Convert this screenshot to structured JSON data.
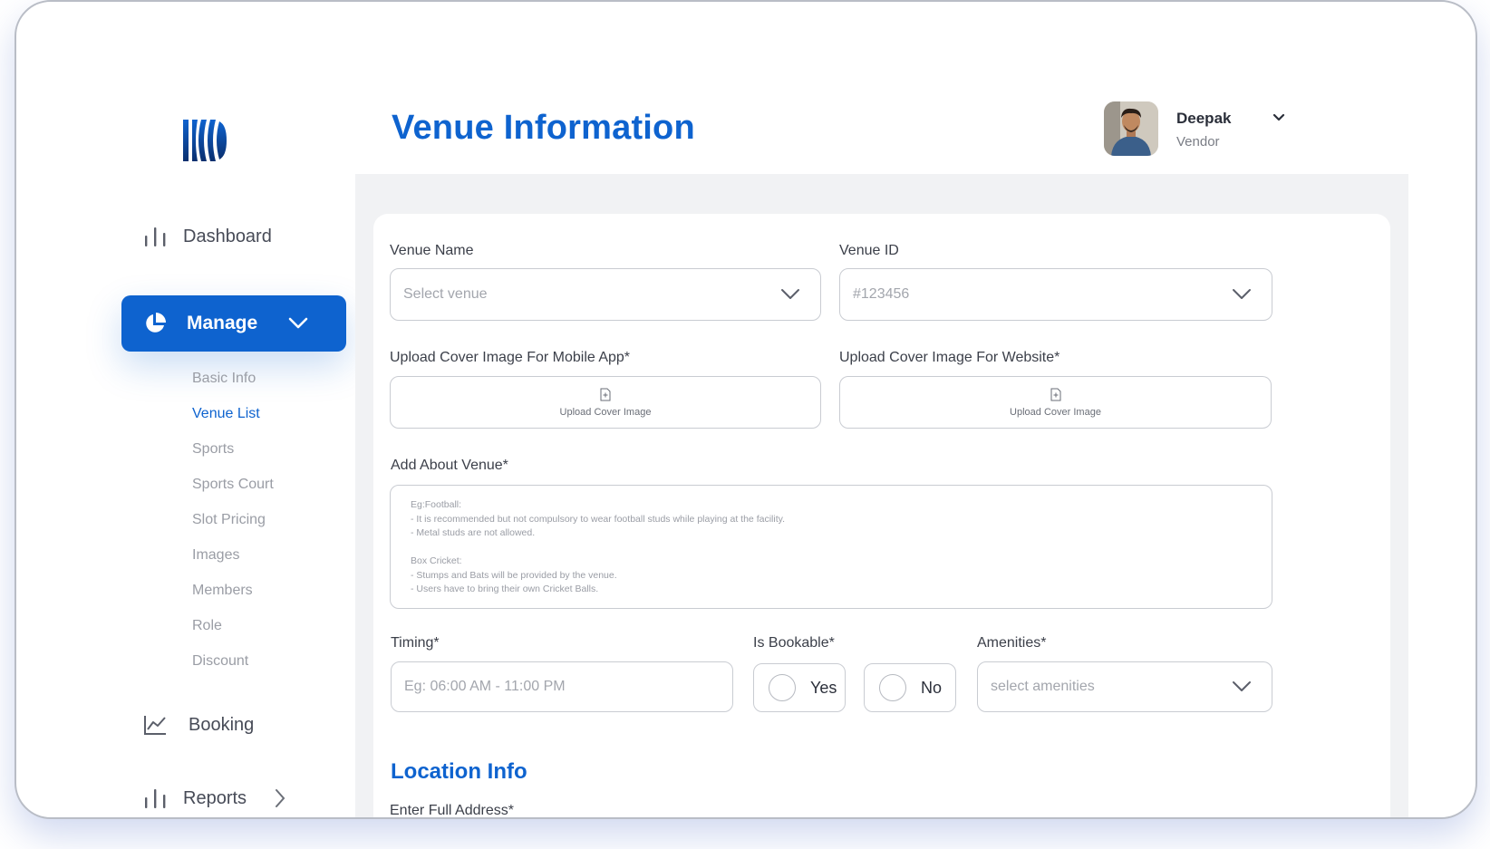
{
  "brand": {
    "logo_icon": "stripes-circle-logo",
    "accent": "#0e63cf"
  },
  "sidebar": {
    "dashboard_label": "Dashboard",
    "manage_label": "Manage",
    "submenu": [
      "Basic Info",
      "Venue List",
      "Sports",
      "Sports Court",
      "Slot Pricing",
      "Images",
      "Members",
      "Role",
      "Discount"
    ],
    "active_submenu": "Venue List",
    "booking_label": "Booking",
    "reports_label": "Reports"
  },
  "header": {
    "title": "Venue Information",
    "user": {
      "name": "Deepak",
      "role": "Vendor"
    }
  },
  "form": {
    "venue_name": {
      "label": "Venue Name",
      "placeholder": "Select venue"
    },
    "venue_id": {
      "label": "Venue ID",
      "placeholder": "#123456"
    },
    "cover_mobile": {
      "label": "Upload Cover Image For Mobile App*",
      "button_text": "Upload Cover Image"
    },
    "cover_web": {
      "label": "Upload Cover Image For Website*",
      "button_text": "Upload Cover Image"
    },
    "about": {
      "label": "Add About Venue*",
      "placeholder_lines": [
        "Eg:Football:",
        "- It is recommended but not compulsory to wear football studs while playing at the facility.",
        "- Metal studs are not allowed.",
        "",
        "Box Cricket:",
        "- Stumps and Bats will be provided by the venue.",
        "- Users have to bring their own Cricket Balls."
      ]
    },
    "timing": {
      "label": "Timing*",
      "placeholder": "Eg: 06:00 AM - 11:00 PM"
    },
    "bookable": {
      "label": "Is Bookable*",
      "yes": "Yes",
      "no": "No"
    },
    "amenities": {
      "label": "Amenities*",
      "placeholder": "select amenities"
    }
  },
  "location": {
    "title": "Location Info",
    "address_label": "Enter Full Address*"
  }
}
